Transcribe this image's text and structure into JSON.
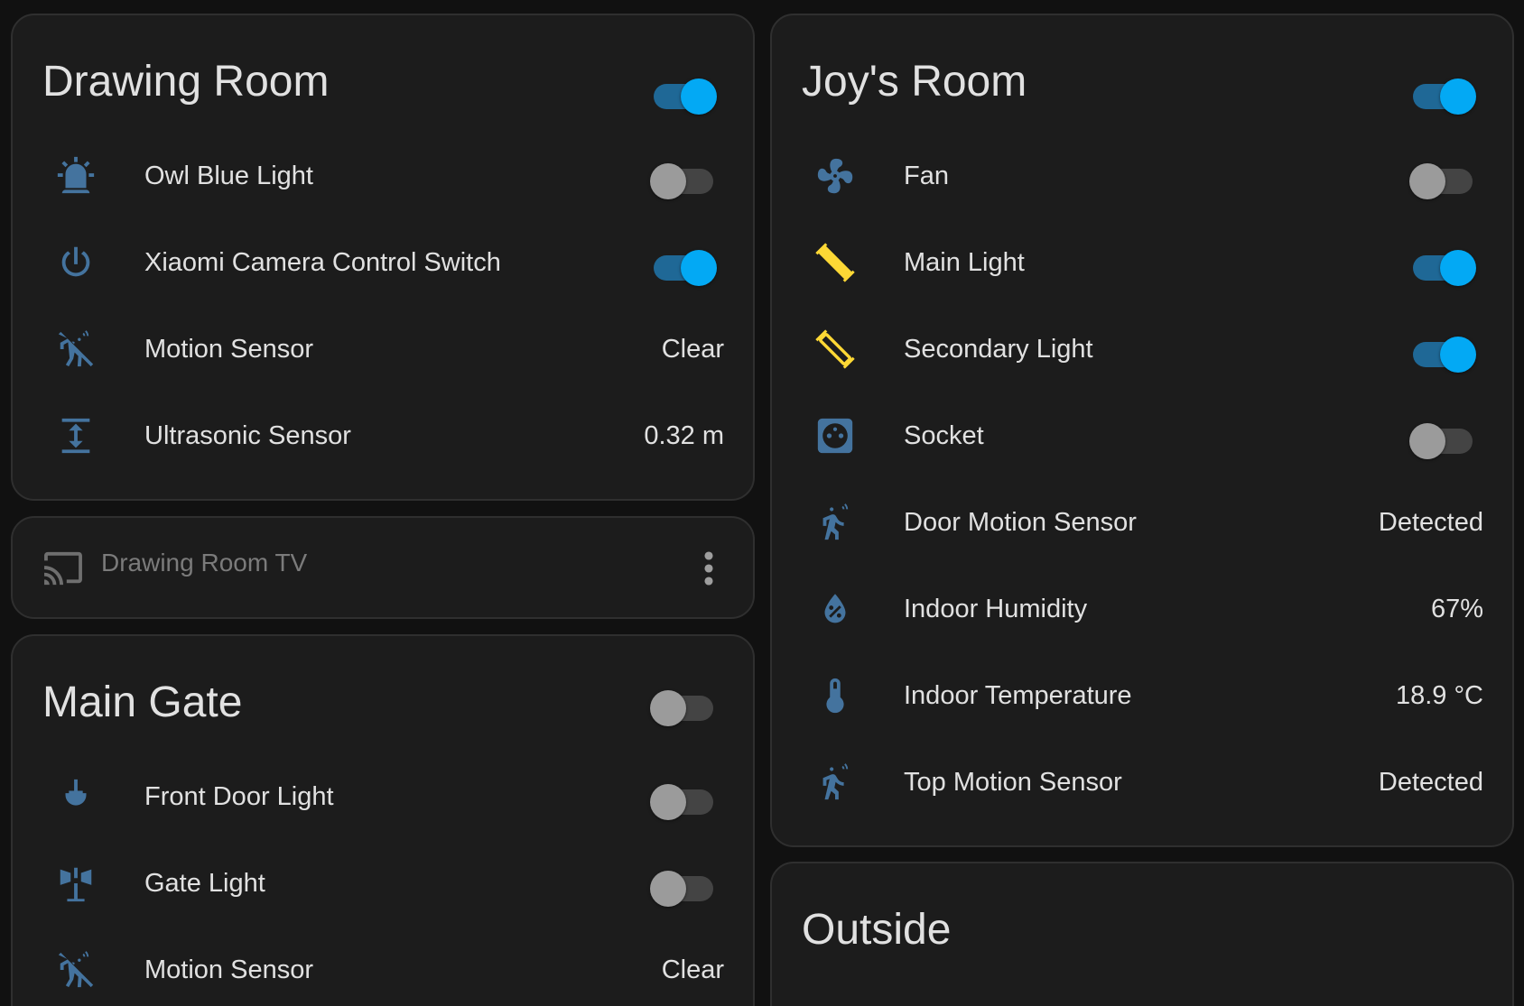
{
  "colors": {
    "background": "#111111",
    "card": "#1c1c1c",
    "icon_blue": "#44739e",
    "icon_active_yellow": "#fdd835",
    "toggle_on_knob": "#03a9f4",
    "toggle_on_track": "#1f6896",
    "toggle_off_knob": "#9b9b9b",
    "toggle_off_track": "#444444"
  },
  "drawing_room": {
    "title": "Drawing Room",
    "header_toggle_on": true,
    "entities": [
      {
        "name": "Owl Blue Light",
        "icon": "alarm-light-icon",
        "toggle": false
      },
      {
        "name": "Xiaomi Camera Control Switch",
        "icon": "power-icon",
        "toggle": true
      },
      {
        "name": "Motion Sensor",
        "icon": "motion-sensor-off-icon",
        "state": "Clear"
      },
      {
        "name": "Ultrasonic Sensor",
        "icon": "arrow-expand-vertical-icon",
        "state": "0.32 m"
      }
    ]
  },
  "drawing_room_tv": {
    "name": "Drawing Room TV",
    "icon": "cast-icon"
  },
  "main_gate": {
    "title": "Main Gate",
    "header_toggle_on": false,
    "entities": [
      {
        "name": "Front Door Light",
        "icon": "ceiling-light-icon",
        "toggle": false
      },
      {
        "name": "Gate Light",
        "icon": "outdoor-lamp-icon",
        "toggle": false
      },
      {
        "name": "Motion Sensor",
        "icon": "motion-sensor-off-icon",
        "state": "Clear"
      }
    ]
  },
  "joys_room": {
    "title": "Joy's Room",
    "header_toggle_on": true,
    "entities": [
      {
        "name": "Fan",
        "icon": "fan-icon",
        "toggle": false
      },
      {
        "name": "Main Light",
        "icon": "tube-light-icon",
        "toggle": true
      },
      {
        "name": "Secondary Light",
        "icon": "tube-light-outline-icon",
        "toggle": true
      },
      {
        "name": "Socket",
        "icon": "power-socket-icon",
        "toggle": false
      },
      {
        "name": "Door Motion Sensor",
        "icon": "motion-sensor-icon",
        "state": "Detected"
      },
      {
        "name": "Indoor Humidity",
        "icon": "water-percent-icon",
        "state": "67%"
      },
      {
        "name": "Indoor Temperature",
        "icon": "thermometer-icon",
        "state": "18.9 °C"
      },
      {
        "name": "Top Motion Sensor",
        "icon": "motion-sensor-icon",
        "state": "Detected"
      }
    ]
  },
  "outside": {
    "title": "Outside"
  }
}
